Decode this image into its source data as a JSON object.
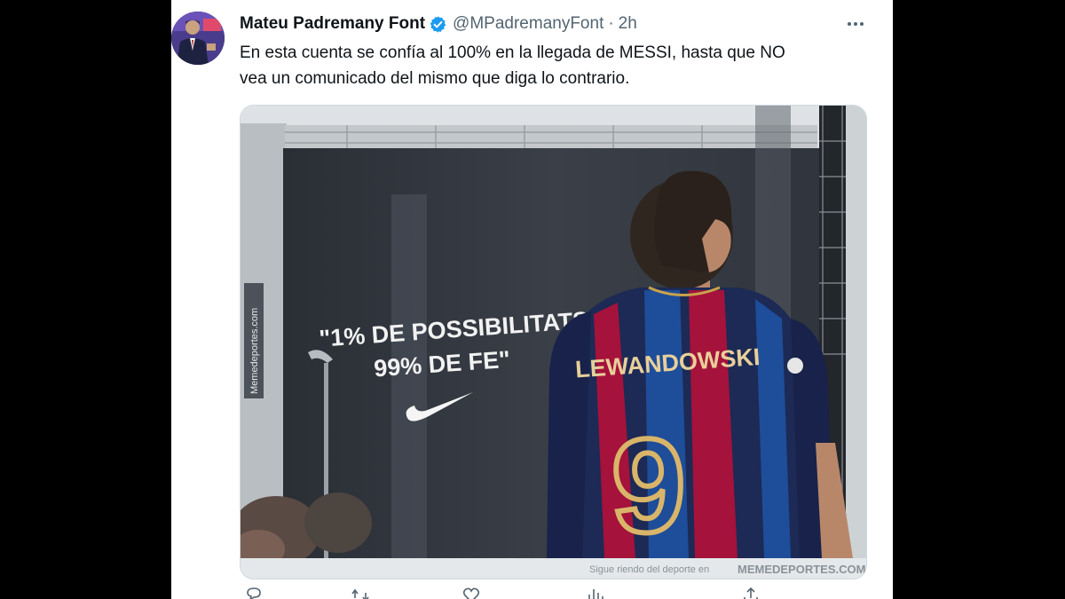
{
  "tweet": {
    "author_name": "Mateu Padremany Font",
    "author_handle": "@MPadremanyFont",
    "separator": "·",
    "timestamp": "2h",
    "text_line_1": "En esta cuenta se confía al 100% en la llegada de MESSI, hasta que NO",
    "text_line_2": "vea un comunicado del mismo que diga lo contrario."
  },
  "media": {
    "slogan_line_1": "\"1% DE POSSIBILITATS,",
    "slogan_line_2": "99% DE FE\"",
    "jersey_name": "LEWANDOWSKI",
    "jersey_number": "9",
    "side_watermark": "Memedeportes.com",
    "footer_text": "Sigue riendo del deporte en",
    "footer_brand": "MEMEDEPORTES.COM"
  },
  "icons": {
    "more": "more-icon",
    "verified": "verified-badge-icon",
    "reply": "reply-icon",
    "retweet": "retweet-icon",
    "like": "like-icon",
    "views": "views-icon",
    "share": "share-icon"
  },
  "colors": {
    "verified_blue": "#1d9bf0",
    "text_primary": "#0f1419",
    "text_secondary": "#536471",
    "barca_blue": "#1c3f8a",
    "barca_red": "#a50044",
    "jersey_gold": "#d9b56a"
  }
}
